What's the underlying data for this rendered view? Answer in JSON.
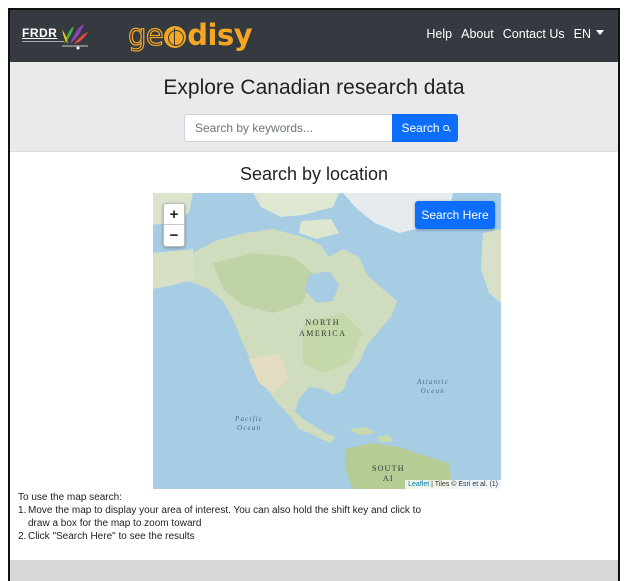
{
  "navbar": {
    "frdr_logo_text": "FRDR",
    "app_logo": {
      "geo": "ge",
      "o_icon": "globe-icon",
      "disy": "disy"
    },
    "links": [
      "Help",
      "About",
      "Contact Us"
    ],
    "language": "EN"
  },
  "hero": {
    "title": "Explore Canadian research data",
    "search_placeholder": "Search by keywords...",
    "search_button": "Search"
  },
  "location": {
    "title": "Search by location",
    "zoom_in": "+",
    "zoom_out": "−",
    "search_here_button": "Search Here",
    "labels": {
      "north_america_1": "NORTH",
      "north_america_2": "AMERICA",
      "atlantic_1": "Atlantic",
      "atlantic_2": "Ocean",
      "pacific_1": "Pacific",
      "pacific_2": "Ocean",
      "south_america_1": "SOUTH",
      "south_america_2": "AI"
    },
    "attribution_link": "Leaflet",
    "attribution_text": " | Tiles © Esri et al. (1)"
  },
  "instructions": {
    "intro": "To use the map search:",
    "steps": [
      {
        "num": "1.",
        "text": "Move the map to display your area of interest. You can also hold the shift key and click to draw a box for the map to zoom toward"
      },
      {
        "num": "2.",
        "text": "Click \"Search Here\" to see the results"
      }
    ]
  },
  "colors": {
    "navbar_bg": "#343a40",
    "brand_orange": "#f5a623",
    "primary_button": "#0d6efd",
    "hero_bg": "#e8eaec",
    "ocean": "#a7cde5"
  }
}
